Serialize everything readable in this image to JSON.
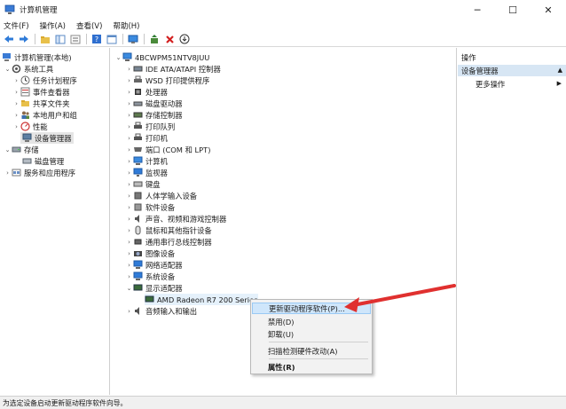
{
  "window": {
    "title": "计算机管理",
    "minimize": "─",
    "maximize": "☐",
    "close": "✕"
  },
  "menu": [
    "文件(F)",
    "操作(A)",
    "查看(V)",
    "帮助(H)"
  ],
  "left_tree": [
    {
      "label": "计算机管理(本地)",
      "icon": "computer-management-icon"
    },
    {
      "label": "系统工具",
      "icon": "system-tools-icon"
    },
    {
      "label": "任务计划程序",
      "icon": "task-scheduler-icon"
    },
    {
      "label": "事件查看器",
      "icon": "event-viewer-icon"
    },
    {
      "label": "共享文件夹",
      "icon": "shared-folder-icon"
    },
    {
      "label": "本地用户和组",
      "icon": "users-icon"
    },
    {
      "label": "性能",
      "icon": "performance-icon"
    },
    {
      "label": "设备管理器",
      "icon": "device-manager-icon"
    },
    {
      "label": "存储",
      "icon": "storage-icon"
    },
    {
      "label": "磁盘管理",
      "icon": "disk-management-icon"
    },
    {
      "label": "服务和应用程序",
      "icon": "services-icon"
    }
  ],
  "device_tree": {
    "root": "4BCWPM51NTV8JUU",
    "categories": [
      {
        "label": "IDE ATA/ATAPI 控制器",
        "icon": "ide-controller-icon"
      },
      {
        "label": "WSD 打印提供程序",
        "icon": "printer-icon"
      },
      {
        "label": "处理器",
        "icon": "processor-icon"
      },
      {
        "label": "磁盘驱动器",
        "icon": "disk-drive-icon"
      },
      {
        "label": "存储控制器",
        "icon": "storage-controller-icon"
      },
      {
        "label": "打印队列",
        "icon": "print-queue-icon"
      },
      {
        "label": "打印机",
        "icon": "printer-icon"
      },
      {
        "label": "端口 (COM 和 LPT)",
        "icon": "port-icon"
      },
      {
        "label": "计算机",
        "icon": "computer-icon"
      },
      {
        "label": "监视器",
        "icon": "monitor-icon"
      },
      {
        "label": "键盘",
        "icon": "keyboard-icon"
      },
      {
        "label": "人体学输入设备",
        "icon": "hid-icon"
      },
      {
        "label": "软件设备",
        "icon": "software-device-icon"
      },
      {
        "label": "声音、视频和游戏控制器",
        "icon": "sound-icon"
      },
      {
        "label": "鼠标和其他指针设备",
        "icon": "mouse-icon"
      },
      {
        "label": "通用串行总线控制器",
        "icon": "usb-icon"
      },
      {
        "label": "图像设备",
        "icon": "imaging-device-icon"
      },
      {
        "label": "网络适配器",
        "icon": "network-adapter-icon"
      },
      {
        "label": "系统设备",
        "icon": "system-device-icon"
      },
      {
        "label": "显示适配器",
        "icon": "display-adapter-icon"
      }
    ],
    "child_device": "AMD Radeon R7 200 Series",
    "after_child": "音频输入和输出"
  },
  "actions": {
    "header": "操作",
    "group": "设备管理器",
    "more": "更多操作"
  },
  "context_menu": {
    "update_driver": "更新驱动程序软件(P)...",
    "disable": "禁用(D)",
    "uninstall": "卸载(U)",
    "scan": "扫描检测硬件改动(A)",
    "properties": "属性(R)"
  },
  "status_text": "为选定设备启动更新驱动程序软件向导。",
  "colors": {
    "accent_blue": "#2f7bd8",
    "arrow_red": "#e0302f",
    "selection_gray": "#e5e5e5",
    "actions_group_bg": "#d7e6f4"
  }
}
